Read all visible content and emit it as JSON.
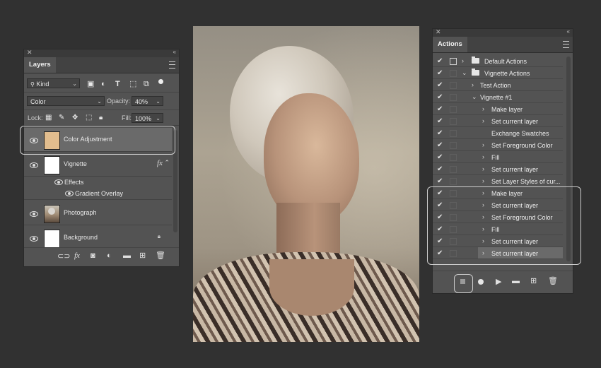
{
  "layers_panel": {
    "title": "Layers",
    "filter_kind": "Kind",
    "blend_mode": "Color",
    "opacity_label": "Opacity:",
    "opacity_value": "40%",
    "lock_label": "Lock:",
    "fill_label": "Fill:",
    "fill_value": "100%",
    "layers": [
      {
        "name": "Color Adjustment",
        "selected": true,
        "thumb_color": "#e2bd8e"
      },
      {
        "name": "Vignette",
        "fx": "fx"
      },
      {
        "name": "Photograph"
      },
      {
        "name": "Background",
        "locked": true
      }
    ],
    "effects_label": "Effects",
    "gradient_overlay_label": "Gradient Overlay"
  },
  "actions_panel": {
    "title": "Actions",
    "items": [
      {
        "label": "Default Actions",
        "type": "set",
        "expanded": false
      },
      {
        "label": "Vignette Actions",
        "type": "set",
        "expanded": true
      },
      {
        "label": "Test Action",
        "type": "action",
        "expanded": false
      },
      {
        "label": "Vignette #1",
        "type": "action",
        "expanded": true
      },
      {
        "label": "Make layer",
        "type": "step"
      },
      {
        "label": "Set current layer",
        "type": "step"
      },
      {
        "label": "Exchange Swatches",
        "type": "step"
      },
      {
        "label": "Set Foreground Color",
        "type": "step"
      },
      {
        "label": "Fill",
        "type": "step"
      },
      {
        "label": "Set current layer",
        "type": "step"
      },
      {
        "label": "Set Layer Styles of cur...",
        "type": "step"
      },
      {
        "label": "Make layer",
        "type": "step"
      },
      {
        "label": "Set current layer",
        "type": "step"
      },
      {
        "label": "Set Foreground Color",
        "type": "step"
      },
      {
        "label": "Fill",
        "type": "step"
      },
      {
        "label": "Set current layer",
        "type": "step"
      },
      {
        "label": "Set current layer",
        "type": "step",
        "selected": true
      }
    ]
  },
  "colors": {
    "panel_bg": "#535353",
    "canvas_bg": "#313131",
    "selected_row": "#6a6a6a",
    "color_adjustment_swatch": "#e2bd8e"
  }
}
